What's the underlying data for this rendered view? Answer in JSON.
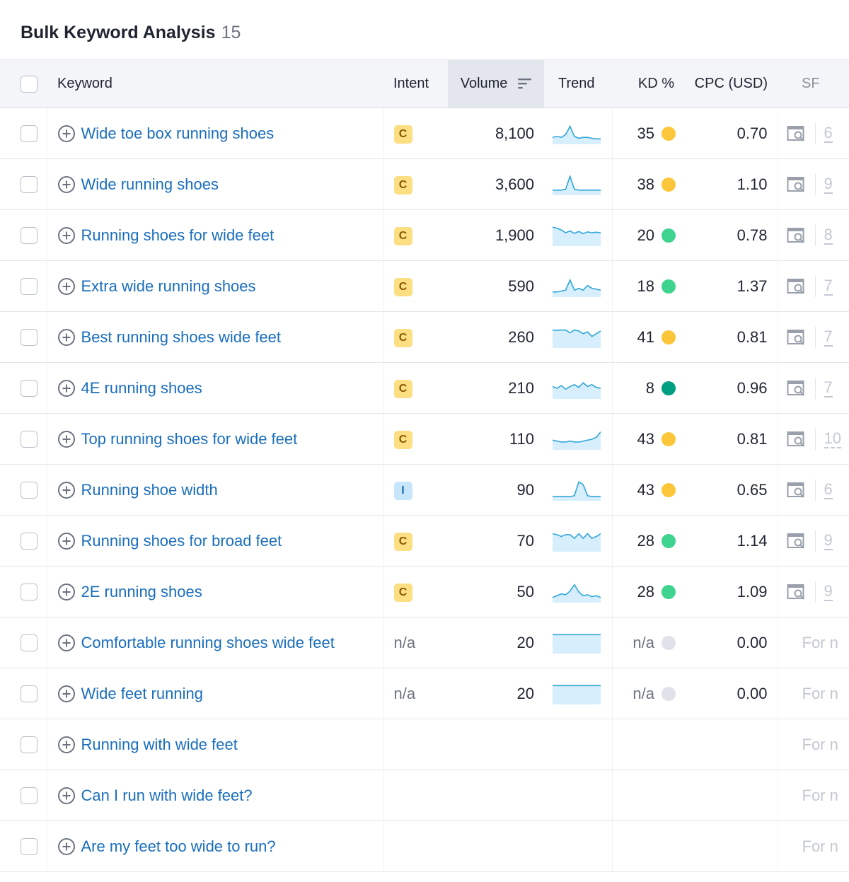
{
  "page": {
    "title": "Bulk Keyword Analysis",
    "count": "15"
  },
  "columns": {
    "keyword": "Keyword",
    "intent": "Intent",
    "volume": "Volume",
    "trend": "Trend",
    "kd": "KD %",
    "cpc": "CPC (USD)",
    "sf": "SF"
  },
  "colors": {
    "link": "#1a6ebd",
    "dot_yellow": "#fcc63a",
    "dot_green": "#3ed38e",
    "dot_dark_green": "#009f81",
    "dot_gray": "#e0e1e9",
    "trend_line": "#30a7d8",
    "trend_fill": "#d7eefc"
  },
  "icons": {
    "row_add": "plus-circle-icon",
    "sort": "sort-descending-icon",
    "serp": "serp-features-icon"
  },
  "rows": [
    {
      "keyword": "Wide toe box running shoes",
      "intent": "C",
      "volume": "8,100",
      "trend": [
        0.3,
        0.35,
        0.3,
        0.45,
        0.9,
        0.35,
        0.25,
        0.3,
        0.3,
        0.25,
        0.22,
        0.22
      ],
      "kd": "35",
      "kd_level": "yellow",
      "cpc": "0.70",
      "sf": "6"
    },
    {
      "keyword": "Wide running shoes",
      "intent": "C",
      "volume": "3,600",
      "trend": [
        0.2,
        0.2,
        0.2,
        0.25,
        0.95,
        0.25,
        0.2,
        0.2,
        0.2,
        0.2,
        0.2,
        0.2
      ],
      "kd": "38",
      "kd_level": "yellow",
      "cpc": "1.10",
      "sf": "9"
    },
    {
      "keyword": "Running shoes for wide feet",
      "intent": "C",
      "volume": "1,900",
      "trend": [
        0.95,
        0.9,
        0.8,
        0.65,
        0.75,
        0.62,
        0.72,
        0.6,
        0.7,
        0.65,
        0.68,
        0.65
      ],
      "kd": "20",
      "kd_level": "green",
      "cpc": "0.78",
      "sf": "8"
    },
    {
      "keyword": "Extra wide running shoes",
      "intent": "C",
      "volume": "590",
      "trend": [
        0.2,
        0.2,
        0.25,
        0.3,
        0.85,
        0.3,
        0.4,
        0.3,
        0.55,
        0.4,
        0.35,
        0.3
      ],
      "kd": "18",
      "kd_level": "green",
      "cpc": "1.37",
      "sf": "7"
    },
    {
      "keyword": "Best running shoes wide feet",
      "intent": "C",
      "volume": "260",
      "trend": [
        0.9,
        0.88,
        0.9,
        0.9,
        0.75,
        0.9,
        0.85,
        0.7,
        0.8,
        0.55,
        0.7,
        0.85
      ],
      "kd": "41",
      "kd_level": "yellow",
      "cpc": "0.81",
      "sf": "7"
    },
    {
      "keyword": "4E running shoes",
      "intent": "C",
      "volume": "210",
      "trend": [
        0.6,
        0.5,
        0.65,
        0.45,
        0.6,
        0.7,
        0.55,
        0.8,
        0.6,
        0.7,
        0.55,
        0.5
      ],
      "kd": "8",
      "kd_level": "dark_green",
      "cpc": "0.96",
      "sf": "7"
    },
    {
      "keyword": "Top running shoes for wide feet",
      "intent": "C",
      "volume": "110",
      "trend": [
        0.45,
        0.4,
        0.35,
        0.35,
        0.4,
        0.35,
        0.35,
        0.4,
        0.45,
        0.5,
        0.6,
        0.9
      ],
      "kd": "43",
      "kd_level": "yellow",
      "cpc": "0.81",
      "sf": "10"
    },
    {
      "keyword": "Running shoe width",
      "intent": "I",
      "volume": "90",
      "trend": [
        0.15,
        0.15,
        0.15,
        0.15,
        0.15,
        0.2,
        0.95,
        0.8,
        0.2,
        0.15,
        0.15,
        0.15
      ],
      "kd": "43",
      "kd_level": "yellow",
      "cpc": "0.65",
      "sf": "6"
    },
    {
      "keyword": "Running shoes for broad feet",
      "intent": "C",
      "volume": "70",
      "trend": [
        0.9,
        0.85,
        0.75,
        0.85,
        0.85,
        0.65,
        0.9,
        0.65,
        0.9,
        0.65,
        0.75,
        0.9
      ],
      "kd": "28",
      "kd_level": "green",
      "cpc": "1.14",
      "sf": "9"
    },
    {
      "keyword": "2E running shoes",
      "intent": "C",
      "volume": "50",
      "trend": [
        0.2,
        0.3,
        0.4,
        0.35,
        0.55,
        0.9,
        0.5,
        0.3,
        0.35,
        0.25,
        0.3,
        0.2
      ],
      "kd": "28",
      "kd_level": "green",
      "cpc": "1.09",
      "sf": "9"
    },
    {
      "keyword": "Comfortable running shoes wide feet",
      "intent": "n/a",
      "volume": "20",
      "trend": [
        0.95,
        0.95,
        0.95,
        0.95,
        0.95,
        0.95,
        0.95,
        0.95,
        0.95,
        0.95,
        0.95,
        0.95
      ],
      "kd": "n/a",
      "kd_level": "gray",
      "cpc": "0.00",
      "sf": "For n"
    },
    {
      "keyword": "Wide feet running",
      "intent": "n/a",
      "volume": "20",
      "trend": [
        0.95,
        0.95,
        0.95,
        0.95,
        0.95,
        0.95,
        0.95,
        0.95,
        0.95,
        0.95,
        0.95,
        0.95
      ],
      "kd": "n/a",
      "kd_level": "gray",
      "cpc": "0.00",
      "sf": "For n"
    },
    {
      "keyword": "Running with wide feet",
      "intent": "",
      "volume": "",
      "trend": null,
      "kd": "",
      "kd_level": "",
      "cpc": "",
      "sf": "For n"
    },
    {
      "keyword": "Can I run with wide feet?",
      "intent": "",
      "volume": "",
      "trend": null,
      "kd": "",
      "kd_level": "",
      "cpc": "",
      "sf": "For n"
    },
    {
      "keyword": "Are my feet too wide to run?",
      "intent": "",
      "volume": "",
      "trend": null,
      "kd": "",
      "kd_level": "",
      "cpc": "",
      "sf": "For n"
    }
  ]
}
